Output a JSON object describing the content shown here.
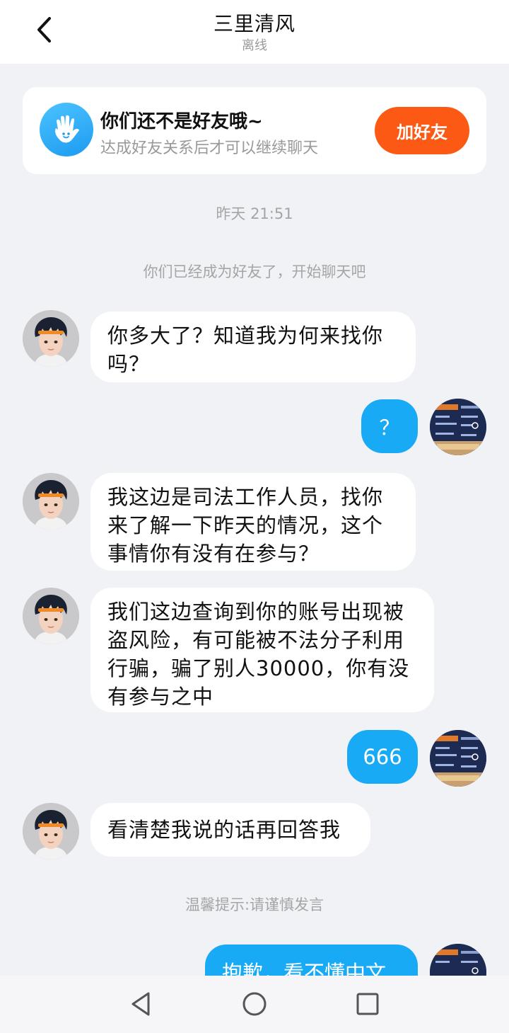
{
  "header": {
    "title": "三里清风",
    "status": "离线"
  },
  "banner": {
    "title": "你们还不是好友哦~",
    "subtitle": "达成好友关系后才可以继续聊天",
    "add_button": "加好友"
  },
  "system": {
    "timestamp": "昨天 21:51",
    "friend_notice": "你们已经成为好友了，开始聊天吧",
    "tip": "温馨提示:请谨慎发言"
  },
  "messages": [
    {
      "side": "left",
      "text": "你多大了？知道我为何来找你吗？"
    },
    {
      "side": "right",
      "text": "？"
    },
    {
      "side": "left",
      "text": "我这边是司法工作人员，找你来了解一下昨天的情况，这个事情你有没有在参与？"
    },
    {
      "side": "left",
      "text": "我们这边查询到你的账号出现被盗风险，有可能被不法分子利用行骗，骗了别人30000，你有没有参与之中"
    },
    {
      "side": "right",
      "text": "666"
    },
    {
      "side": "left",
      "text": "看清楚我说的话再回答我"
    },
    {
      "side": "right",
      "text": "抱歉，看不懂中文"
    }
  ],
  "icons": {
    "back": "chevron-left-icon",
    "banner": "hand-wave-icon",
    "nav_back": "triangle-back-icon",
    "nav_home": "circle-home-icon",
    "nav_recent": "square-recent-icon"
  },
  "colors": {
    "accent": "#19aaf5",
    "add_button": "#fc5a14",
    "background": "#f1f2f6"
  }
}
